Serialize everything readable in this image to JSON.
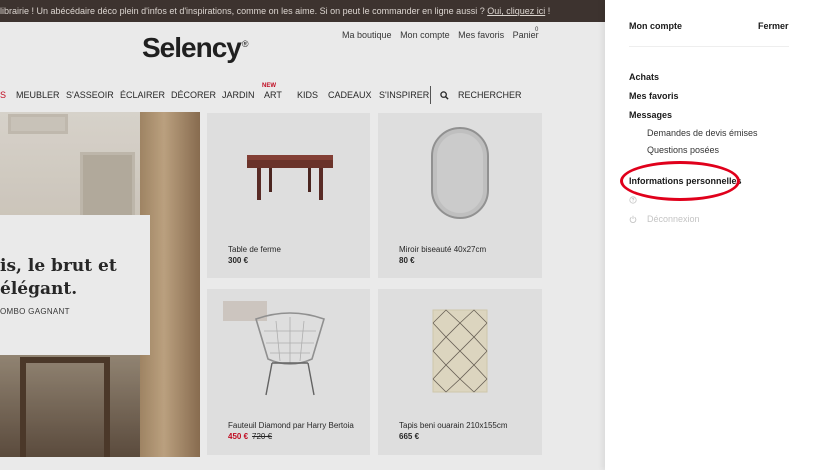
{
  "promo": {
    "text": "librairie ! Un abécédaire déco plein d'infos et d'inspirations, comme on les aime. Si on peut le commander en ligne aussi ? ",
    "link": "Oui, cliquez ici",
    "end": " !"
  },
  "header": {
    "logo": "Selency",
    "logo_mark": "®",
    "links": [
      "Ma boutique",
      "Mon compte",
      "Mes favoris",
      "Panier"
    ],
    "cart_count": "0"
  },
  "nav": {
    "items": [
      "S",
      "MEUBLER",
      "S'ASSEOIR",
      "ÉCLAIRER",
      "DÉCORER",
      "JARDIN",
      "ART",
      "KIDS",
      "CADEAUX",
      "S'INSPIRER"
    ],
    "new_badge": "NEW",
    "search_label": "RECHERCHER",
    "search_icon": "search-icon"
  },
  "hero": {
    "title": "is, le brut et\nélégant.",
    "subtitle": "OMBO GAGNANT"
  },
  "products": [
    {
      "name": "Table de ferme",
      "price": "300 €"
    },
    {
      "name": "Miroir biseauté 40x27cm",
      "price": "80 €"
    },
    {
      "name": "Fauteuil Diamond par Harry Bertoia",
      "price": "450 €",
      "old_price": "720 €"
    },
    {
      "name": "Tapis beni ouarain 210x155cm",
      "price": "665 €"
    }
  ],
  "drawer": {
    "title": "Mon compte",
    "close": "Fermer",
    "items": [
      "Achats",
      "Mes favoris",
      "Messages"
    ],
    "message_subitems": [
      "Demandes de devis émises",
      "Questions posées"
    ],
    "personal_info": "Informations personnelles",
    "help_icon": "help-circle-icon",
    "logout": "Déconnexion",
    "logout_icon": "power-icon"
  },
  "colors": {
    "promo_bar": "#3b2f2b",
    "sale_red": "#d0021b",
    "highlight": "#e0001b"
  }
}
